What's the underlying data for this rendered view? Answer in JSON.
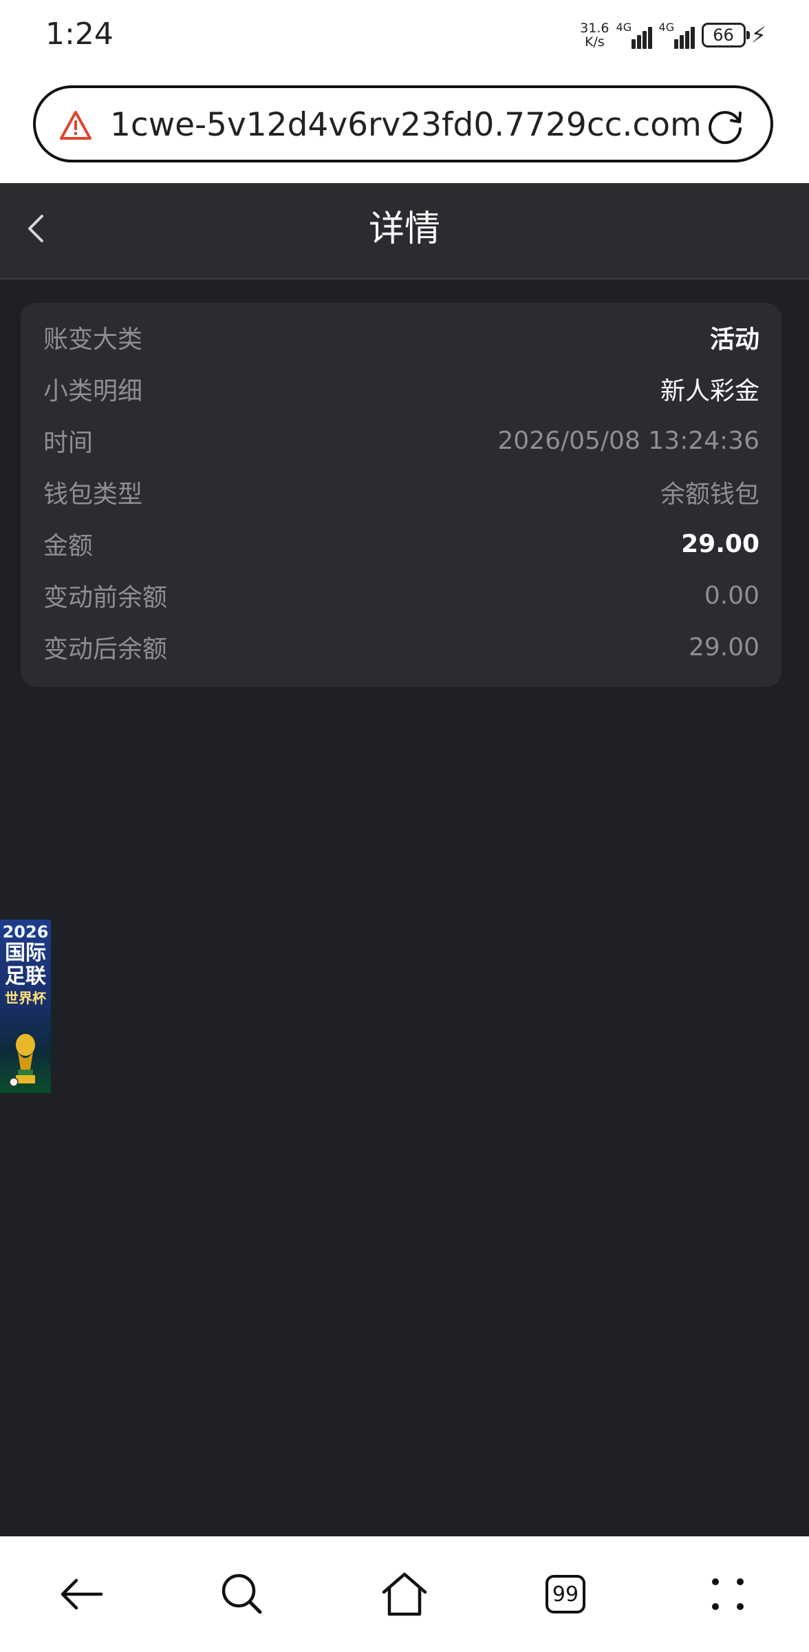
{
  "status_bar": {
    "time": "1:24",
    "net_speed_value": "31.6",
    "net_speed_unit": "K/s",
    "signal1_label": "4G",
    "signal2_label": "4G",
    "battery_level": "66"
  },
  "browser": {
    "url": "1cwe-5v12d4v6rv23fd0.7729cc.com",
    "tabs_count": "99"
  },
  "header": {
    "title": "详情"
  },
  "details": {
    "rows": [
      {
        "label": "账变大类",
        "value": "活动"
      },
      {
        "label": "小类明细",
        "value": "新人彩金"
      },
      {
        "label": "时间",
        "value": "2026/05/08 13:24:36"
      },
      {
        "label": "钱包类型",
        "value": "余额钱包"
      },
      {
        "label": "金额",
        "value": "29.00"
      },
      {
        "label": "变动前余额",
        "value": "0.00"
      },
      {
        "label": "变动后余额",
        "value": "29.00"
      }
    ]
  },
  "floating_banner": {
    "year": "2026",
    "line1": "国际",
    "line2": "足联",
    "line3": "世界杯"
  },
  "colors": {
    "background": "#1f2026",
    "card": "#2b2c31",
    "header": "#2b2c30",
    "muted_text": "#8e8f95",
    "warning": "#e0442f"
  }
}
